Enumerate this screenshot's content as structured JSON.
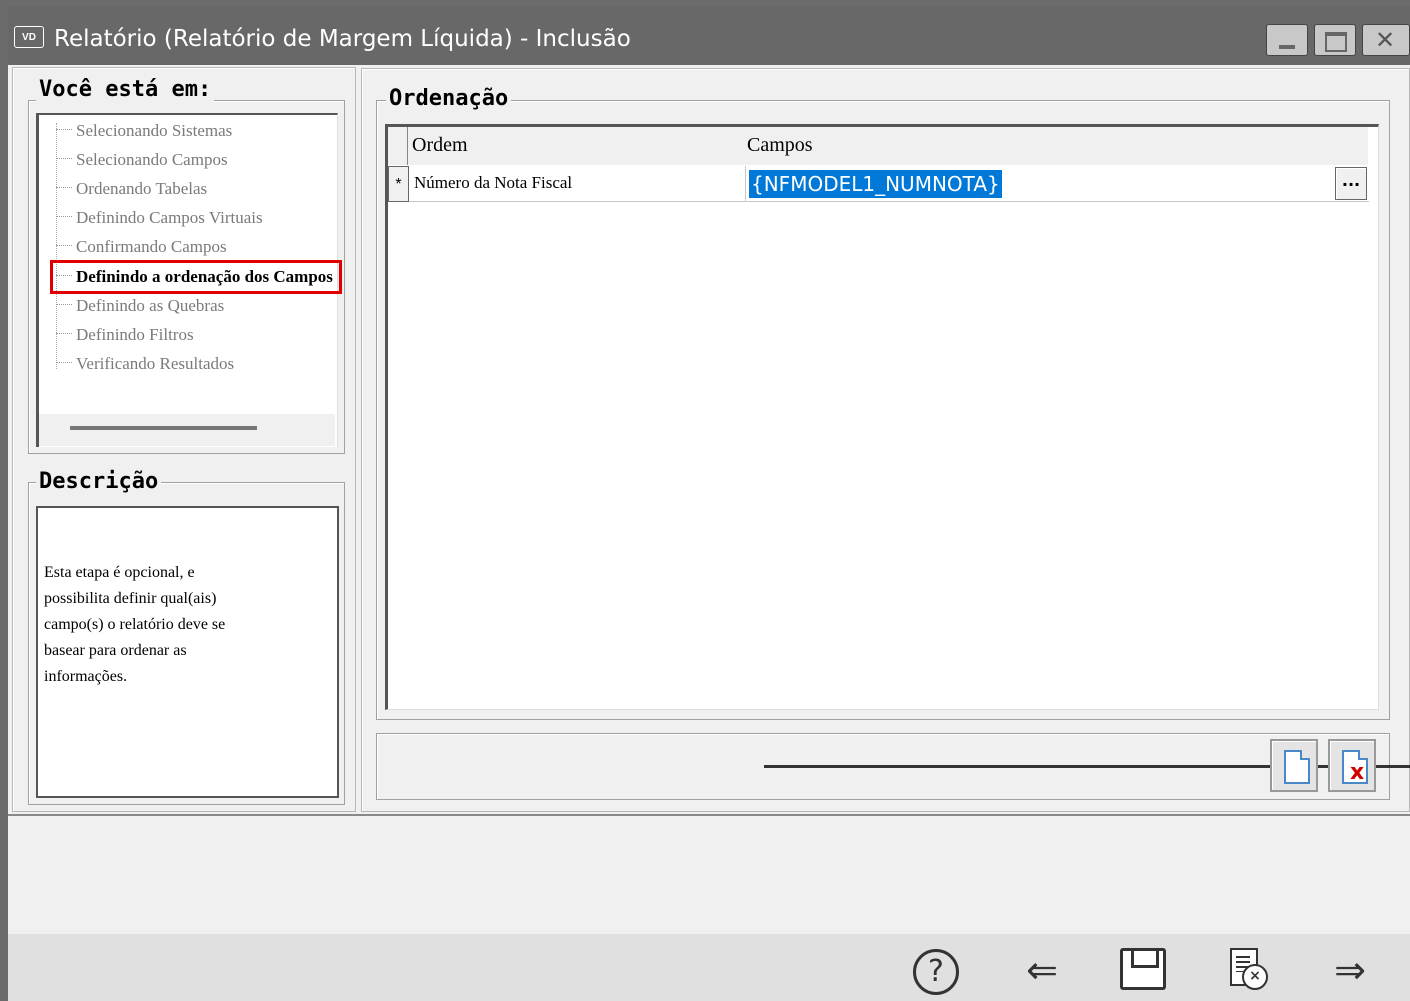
{
  "window": {
    "icon_text": "VD",
    "title": "Relatório (Relatório de Margem Líquida) - Inclusão"
  },
  "wizard": {
    "steps_title": "Você está em:",
    "steps": [
      "Selecionando Sistemas",
      "Selecionando Campos",
      "Ordenando Tabelas",
      "Definindo Campos Virtuais",
      "Confirmando Campos",
      "Definindo a ordenação dos Campos",
      "Definindo as Quebras",
      "Definindo Filtros",
      "Verificando Resultados"
    ],
    "active_step_index": 5
  },
  "description": {
    "title": "Descrição",
    "text_lines": [
      "Esta etapa é opcional, e",
      "possibilita definir qual(ais)",
      "campo(s) o relatório deve se",
      "basear para ordenar as",
      "informações."
    ]
  },
  "ordering": {
    "title": "Ordenação",
    "columns": [
      "Ordem",
      "Campos"
    ],
    "rows": [
      {
        "indicator": "*",
        "ordem": "Número da Nota Fiscal",
        "campos": "{NFMODEL1_NUMNOTA}"
      }
    ],
    "ellipsis_label": "..."
  },
  "toolbar": {
    "help_glyph": "?",
    "back_glyph": "⇐",
    "next_glyph": "⇒",
    "delete_mark": "x",
    "cancel_mark": "×"
  },
  "colors": {
    "titlebar": "#686868",
    "selection": "#0078d7",
    "highlight_border": "#e00000"
  }
}
